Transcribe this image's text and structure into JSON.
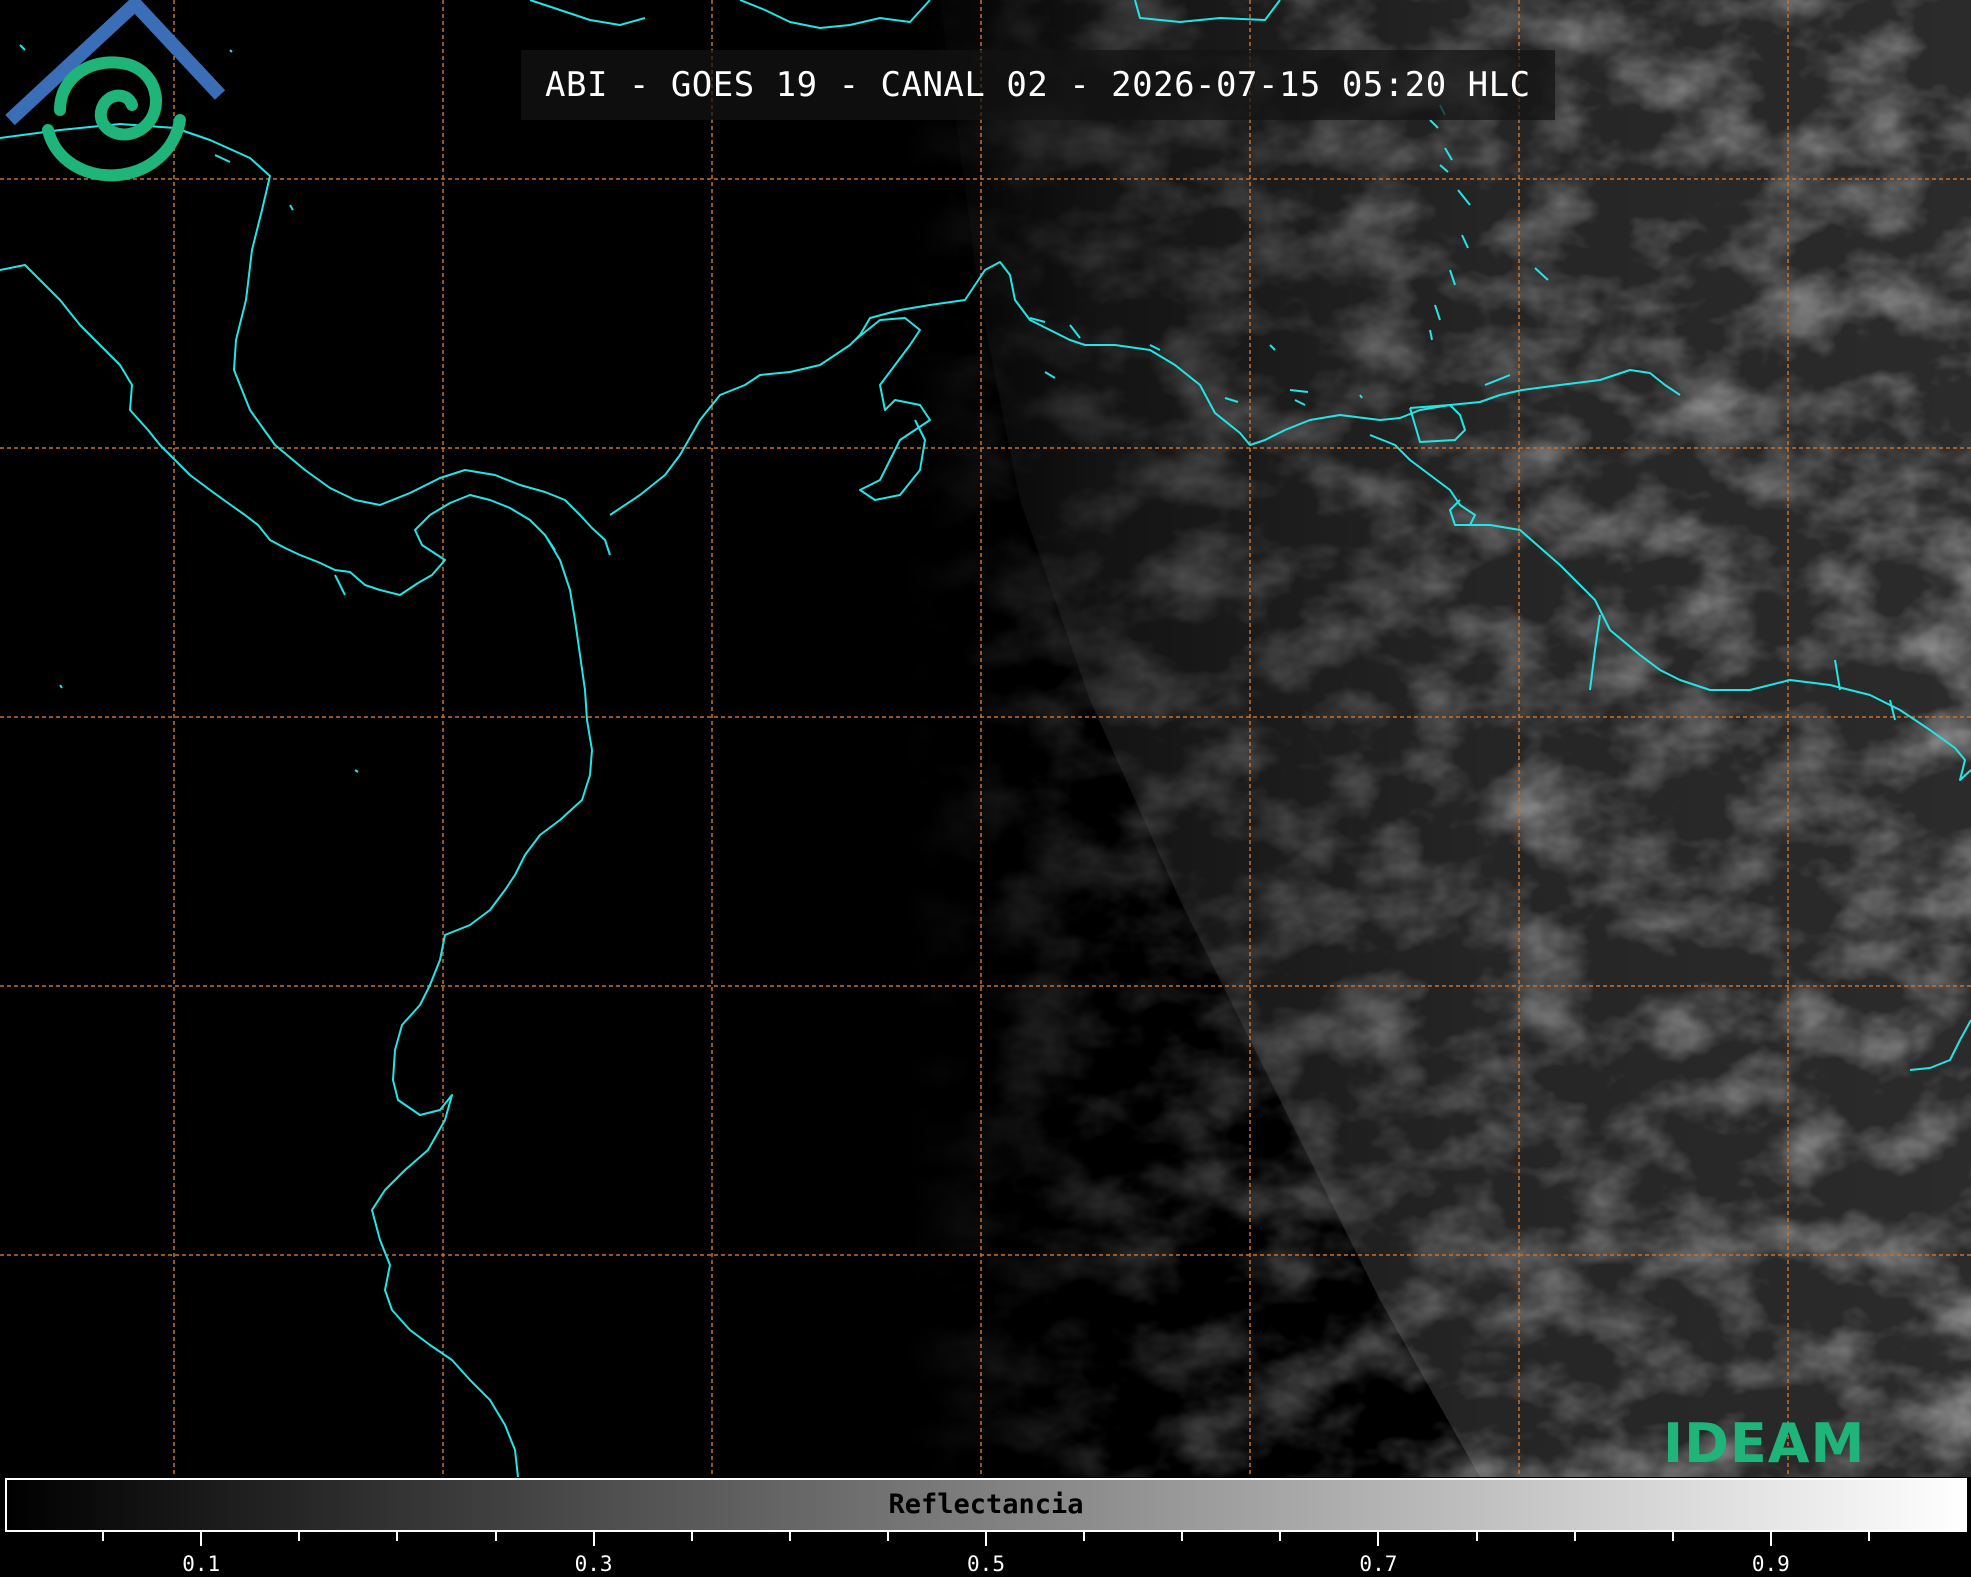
{
  "title": "ABI - GOES 19 - CANAL 02 - 2026-07-15 05:20 HLC",
  "logo": {
    "name": "IDEAM",
    "text": "IDEAM",
    "icon": "ideam-logo-icon"
  },
  "colors": {
    "coastline": "#22e6e6",
    "gridline": "#c8702a",
    "logo_blue": "#3a6fb8",
    "logo_teal": "#1fb47a"
  },
  "colorbar": {
    "label": "Reflectancia",
    "min": 0.0,
    "max": 1.0,
    "tick_labels": [
      "0.1",
      "0.3",
      "0.5",
      "0.7",
      "0.9"
    ],
    "tick_values": [
      0.1,
      0.3,
      0.5,
      0.7,
      0.9
    ],
    "minor_step": 0.05,
    "gradient": [
      "#000000",
      "#ffffff"
    ]
  }
}
